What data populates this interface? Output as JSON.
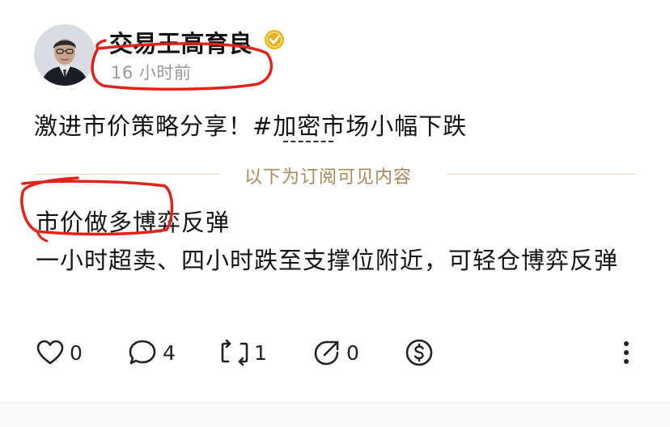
{
  "post": {
    "author": {
      "name": "交易王高育良",
      "time": "16 小时前"
    },
    "title": "激进市价策略分享！#加密市场小幅下跌",
    "divider_label": "以下为订阅可见内容",
    "paywall": {
      "heading": "市价做多博弈反弹",
      "body": "一小时超卖、四小时跌至支撑位附近，可轻仓博弈反弹"
    },
    "actions": {
      "likes": "0",
      "comments": "4",
      "reposts": "1",
      "shares": "0"
    }
  },
  "colors": {
    "annotation_red": "#e0241b",
    "divider_gold": "#a78a5b",
    "verified_badge": "#e8b21d",
    "timestamp_gray": "#9a9a9a"
  },
  "icons": [
    "verified-badge-icon",
    "heart-icon",
    "comment-icon",
    "repost-icon",
    "share-icon",
    "tip-dollar-icon",
    "more-vertical-icon"
  ]
}
